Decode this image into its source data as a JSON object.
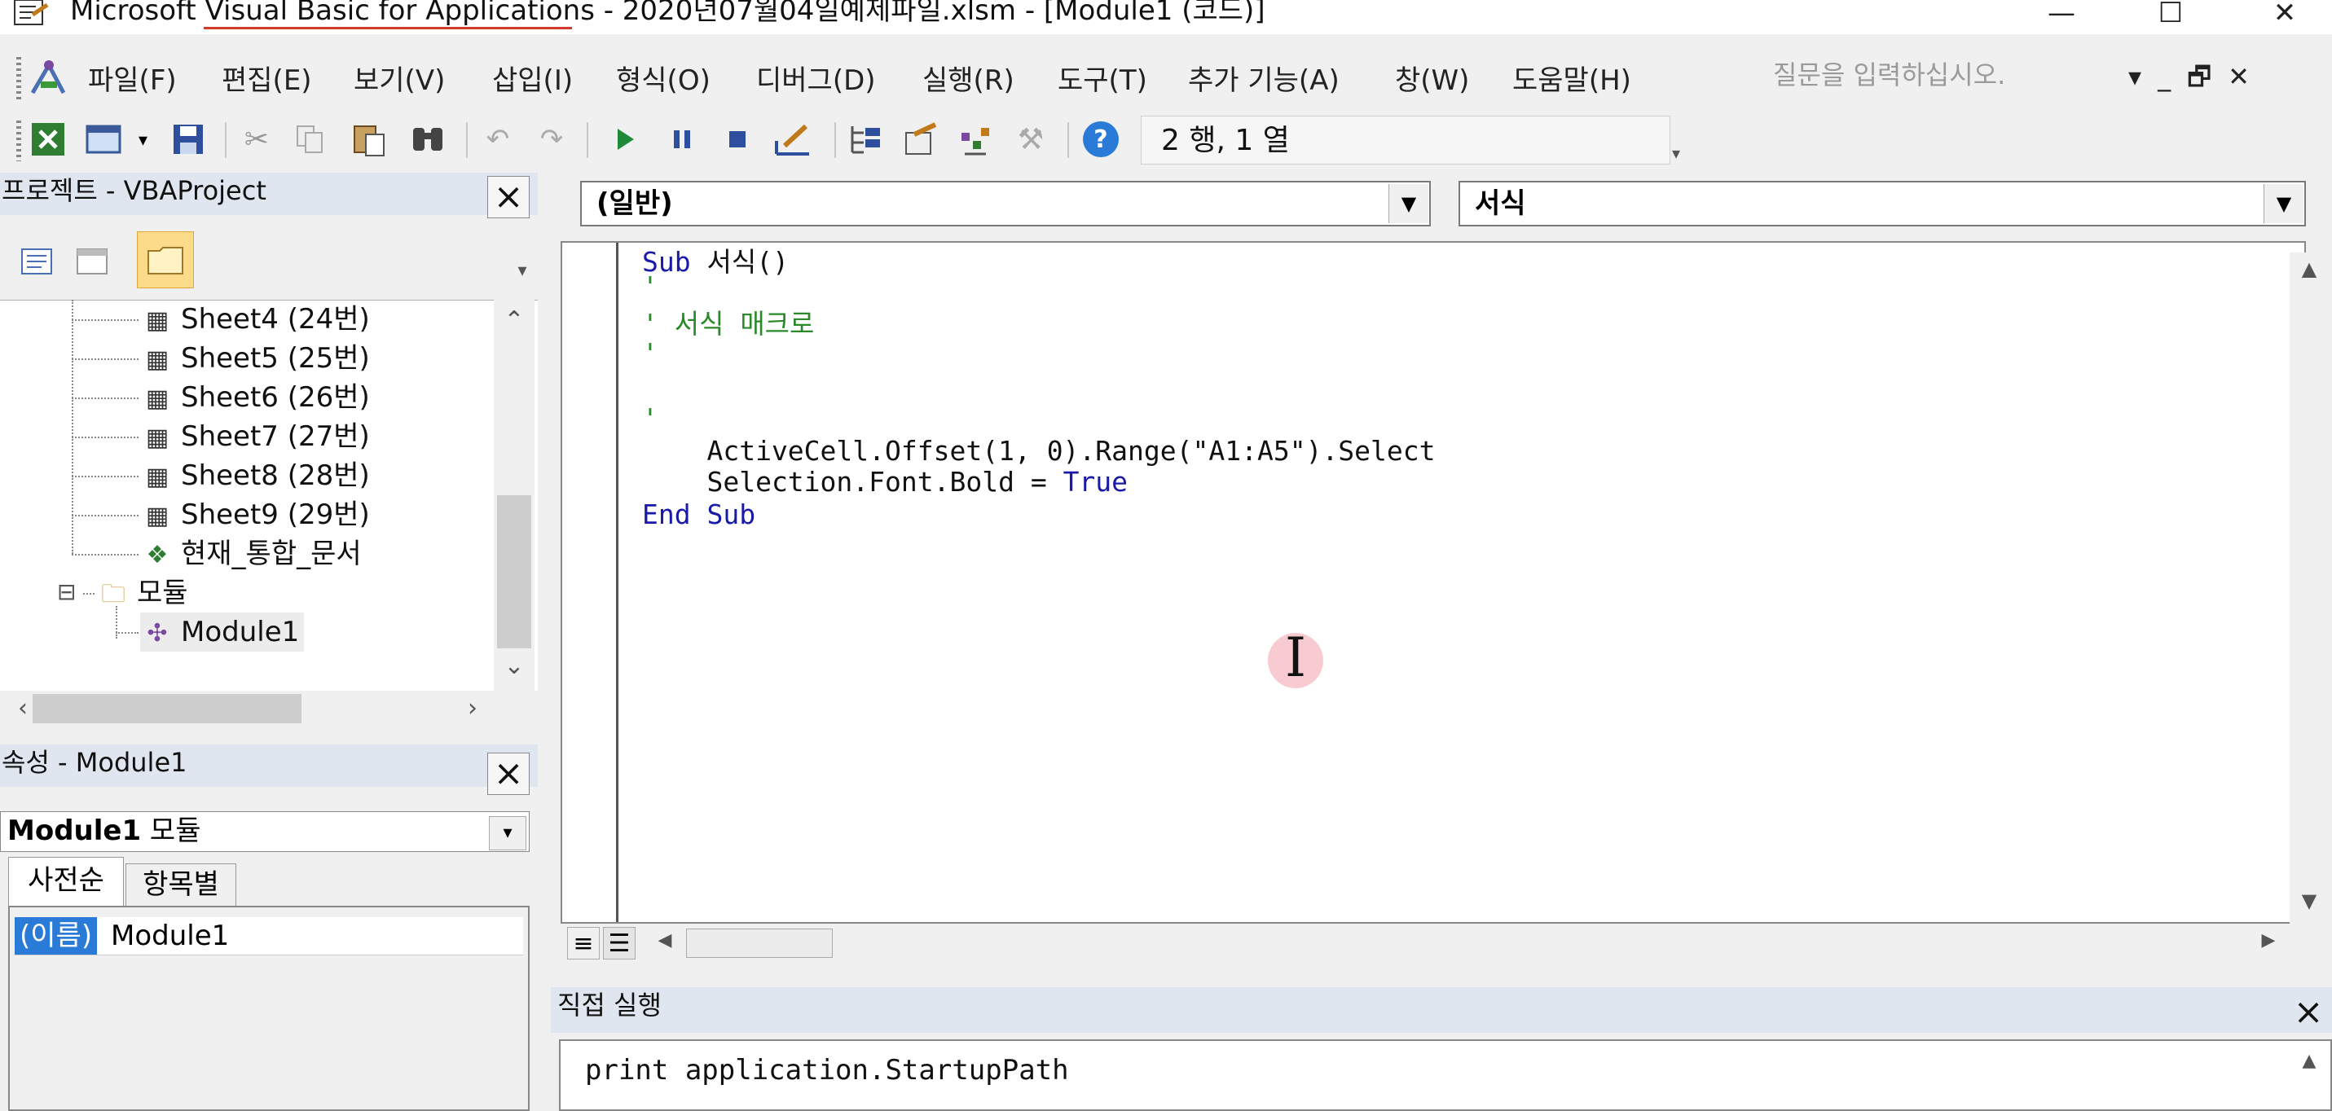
{
  "window": {
    "title": "Microsoft Visual Basic for Applications - 2020년07월04일예제파일.xlsm - [Module1 (코드)]",
    "minimize_glyph": "—",
    "maximize_glyph": "☐",
    "close_glyph": "✕"
  },
  "menu": {
    "items": [
      "파일(F)",
      "편집(E)",
      "보기(V)",
      "삽입(I)",
      "형식(O)",
      "디버그(D)",
      "실행(R)",
      "도구(T)",
      "추가 기능(A)",
      "창(W)",
      "도움말(H)"
    ],
    "help_placeholder": "질문을 입력하십시오.",
    "mdi_controls": [
      "▾",
      "_",
      "🗗",
      "✕"
    ]
  },
  "toolbar": {
    "icons": [
      "excel-view-icon",
      "insert-userform-icon",
      "save-icon",
      "cut-icon",
      "copy-icon",
      "paste-icon",
      "find-icon",
      "undo-icon",
      "redo-icon",
      "run-icon",
      "break-icon",
      "reset-icon",
      "design-mode-icon",
      "project-explorer-icon",
      "properties-window-icon",
      "object-browser-icon",
      "toolbox-icon",
      "help-icon"
    ],
    "position_status": "2 행, 1 열"
  },
  "project_panel": {
    "title": "프로젝트 - VBAProject",
    "tree": [
      {
        "label": "Sheet4 (24번)",
        "icon": "sheet-icon"
      },
      {
        "label": "Sheet5 (25번)",
        "icon": "sheet-icon"
      },
      {
        "label": "Sheet6 (26번)",
        "icon": "sheet-icon"
      },
      {
        "label": "Sheet7 (27번)",
        "icon": "sheet-icon"
      },
      {
        "label": "Sheet8 (28번)",
        "icon": "sheet-icon"
      },
      {
        "label": "Sheet9 (29번)",
        "icon": "sheet-icon"
      },
      {
        "label": "현재_통합_문서",
        "icon": "workbook-icon"
      },
      {
        "label": "모듈",
        "icon": "folder-icon"
      },
      {
        "label": "Module1",
        "icon": "module-icon"
      }
    ],
    "collapse_glyph": "⊟"
  },
  "properties_panel": {
    "title": "속성 - Module1",
    "object_name": "Module1",
    "object_type": "모듈",
    "tabs": [
      "사전순",
      "항목별"
    ],
    "rows": [
      {
        "name": "(이름)",
        "value": "Module1"
      }
    ]
  },
  "code_window": {
    "object_combo": "(일반)",
    "procedure_combo": "서식",
    "lines": [
      {
        "segments": [
          {
            "t": "Sub ",
            "c": "kw"
          },
          {
            "t": "서식()",
            "c": ""
          }
        ]
      },
      {
        "segments": [
          {
            "t": "'",
            "c": "cm"
          }
        ]
      },
      {
        "segments": [
          {
            "t": "' 서식 매크로",
            "c": "cm"
          }
        ]
      },
      {
        "segments": [
          {
            "t": "'",
            "c": "cm"
          }
        ]
      },
      {
        "segments": [
          {
            "t": "",
            "c": ""
          }
        ]
      },
      {
        "segments": [
          {
            "t": "'",
            "c": "cm"
          }
        ]
      },
      {
        "segments": [
          {
            "t": "    ActiveCell.Offset(1, 0).Range(\"A1:A5\").Select",
            "c": ""
          }
        ]
      },
      {
        "segments": [
          {
            "t": "    Selection.Font.Bold = ",
            "c": ""
          },
          {
            "t": "True",
            "c": "kw"
          }
        ]
      },
      {
        "segments": [
          {
            "t": "End Sub",
            "c": "kw"
          }
        ]
      }
    ]
  },
  "immediate": {
    "title": "직접 실행",
    "text": "print application.StartupPath"
  },
  "colors": {
    "keyword": "#1a1aa8",
    "comment": "#2a8a2a",
    "panel_header": "#dfe6ef",
    "title_underline": "#d23a2a"
  }
}
